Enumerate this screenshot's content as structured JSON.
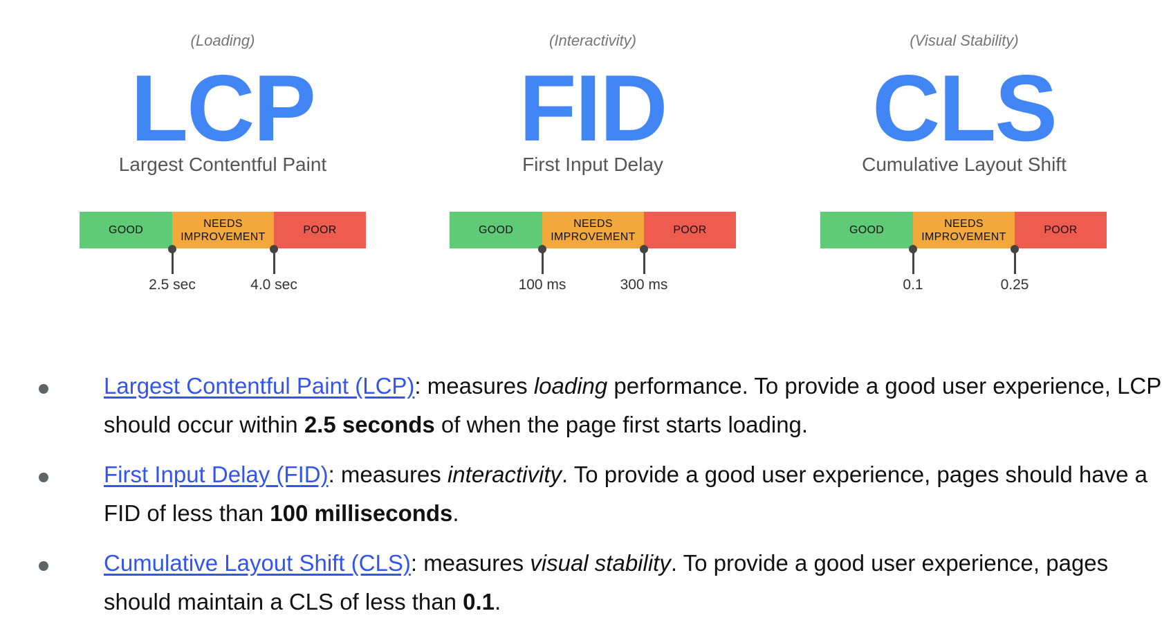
{
  "colors": {
    "accent_blue": "#4285f4",
    "good": "#5fcb76",
    "needs_improvement": "#f2a83b",
    "poor": "#ee5c4f",
    "link": "#3355ee"
  },
  "metrics": [
    {
      "category": "(Loading)",
      "abbr": "LCP",
      "name": "Largest Contentful Paint",
      "segments": {
        "good": "GOOD",
        "needs_improvement_line1": "NEEDS",
        "needs_improvement_line2": "IMPROVEMENT",
        "poor": "POOR"
      },
      "thresholds": [
        "2.5 sec",
        "4.0 sec"
      ]
    },
    {
      "category": "(Interactivity)",
      "abbr": "FID",
      "name": "First Input Delay",
      "segments": {
        "good": "GOOD",
        "needs_improvement_line1": "NEEDS",
        "needs_improvement_line2": "IMPROVEMENT",
        "poor": "POOR"
      },
      "thresholds": [
        "100 ms",
        "300 ms"
      ]
    },
    {
      "category": "(Visual Stability)",
      "abbr": "CLS",
      "name": "Cumulative Layout Shift",
      "segments": {
        "good": "GOOD",
        "needs_improvement_line1": "NEEDS",
        "needs_improvement_line2": "IMPROVEMENT",
        "poor": "POOR"
      },
      "thresholds": [
        "0.1",
        "0.25"
      ]
    }
  ],
  "bullets": [
    {
      "link": "Largest Contentful Paint (LCP)",
      "t1": ": measures ",
      "em": "loading",
      "t2": " performance. To provide a good user experience, LCP should occur within ",
      "strong": "2.5 seconds",
      "t3": " of when the page first starts loading."
    },
    {
      "link": "First Input Delay (FID)",
      "t1": ": measures ",
      "em": "interactivity",
      "t2": ". To provide a good user experience, pages should have a FID of less than ",
      "strong": "100 milliseconds",
      "t3": "."
    },
    {
      "link": "Cumulative Layout Shift (CLS)",
      "t1": ": measures ",
      "em": "visual stability",
      "t2": ". To provide a good user experience, pages should maintain a CLS of less than ",
      "strong": "0.1",
      "t3": "."
    }
  ]
}
